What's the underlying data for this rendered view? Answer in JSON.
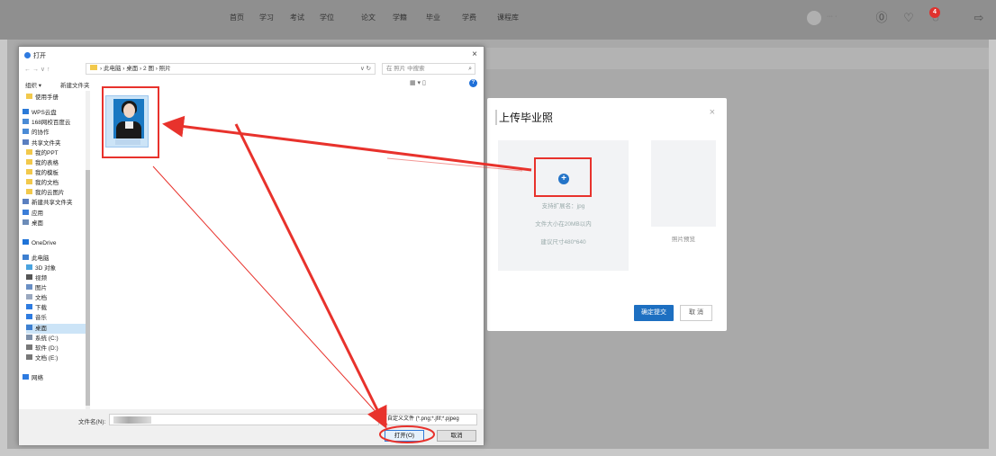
{
  "nav": {
    "links": [
      "首页",
      "学习",
      "考试",
      "学位",
      "论文",
      "学籍",
      "毕业",
      "学费",
      "课程库"
    ],
    "user_name": "··· ·",
    "badge": "4"
  },
  "modal": {
    "title": "上传毕业照",
    "close": "×",
    "plus": "+",
    "hints": [
      "支持扩展名：jpg",
      "文件大小在20MB以内",
      "建议尺寸480*640"
    ],
    "preview_label": "照片预览",
    "submit": "确定提交",
    "cancel": "取 消"
  },
  "dialog": {
    "title": "打开",
    "close": "×",
    "nav_arrows": "← → ∨ ↑",
    "path": "› 此电脑 › 桌面 › 2 图 › 照片",
    "path_controls": "∨ ↻",
    "search_placeholder": "在 照片 中搜索",
    "organize": "组织 ▾",
    "new_folder": "新建文件夹",
    "view_icons": "▦ ▾  ▯",
    "help": "?",
    "nav_items": [
      {
        "label": "使用手册",
        "color": "#f2c94c"
      },
      {
        "label": "WPS云盘",
        "color": "#2b7ad8"
      },
      {
        "label": "168网校百度云",
        "color": "#4a8bd6"
      },
      {
        "label": "的协作",
        "color": "#4a8bd6"
      },
      {
        "label": "共享文件夹",
        "color": "#5a7fc0"
      },
      {
        "label": "我的PPT",
        "color": "#f2c94c"
      },
      {
        "label": "我的表格",
        "color": "#f2c94c"
      },
      {
        "label": "我的模板",
        "color": "#f2c94c"
      },
      {
        "label": "我的文档",
        "color": "#f2c94c"
      },
      {
        "label": "我的云图片",
        "color": "#f2c94c"
      },
      {
        "label": "新建共享文件夹",
        "color": "#5a7fc0"
      },
      {
        "label": "应用",
        "color": "#3b7dd8"
      },
      {
        "label": "桌面",
        "color": "#6c8cb8"
      },
      {
        "label": "OneDrive",
        "color": "#1e73d8"
      },
      {
        "label": "此电脑",
        "color": "#3d7fd0"
      },
      {
        "label": "3D 对象",
        "color": "#4aa3df"
      },
      {
        "label": "视频",
        "color": "#555555"
      },
      {
        "label": "图片",
        "color": "#6a8fc4"
      },
      {
        "label": "文档",
        "color": "#9aa8bf"
      },
      {
        "label": "下载",
        "color": "#2e7be0"
      },
      {
        "label": "音乐",
        "color": "#2e7be0"
      },
      {
        "label": "桌面",
        "color": "#3d7fd0"
      },
      {
        "label": "系统 (C:)",
        "color": "#7d8fa8"
      },
      {
        "label": "软件 (D:)",
        "color": "#777777"
      },
      {
        "label": "文档 (E:)",
        "color": "#777777"
      },
      {
        "label": "网络",
        "color": "#2e7be0"
      }
    ],
    "filename_label": "文件名(N):",
    "filetype": "自定义文件 (*.png;*.jfif;*.pjpeg",
    "open": "打开(O)",
    "cancel": "取消"
  },
  "colors": {
    "accent": "#1d6fc1",
    "annotation": "#e8322c"
  }
}
